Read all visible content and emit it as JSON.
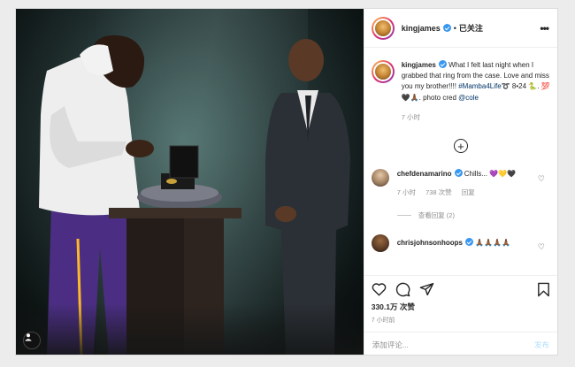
{
  "post": {
    "username": "kingjames",
    "follow_status": "已关注",
    "separator": "•",
    "more": "•••"
  },
  "caption": {
    "username": "kingjames",
    "text": "What I felt last night when I grabbed that ring from the case. Love and miss you my brother!!!!",
    "hashtag": "#Mamba4Life",
    "after_hashtag": "➰ 8•24 🐍. 💯🖤🙏🏾.",
    "photo_credit": "photo cred",
    "mention": "@cole",
    "time": "7 小时"
  },
  "comments": [
    {
      "username": "chefdenamarino",
      "text": "Chills... 💜💛🖤",
      "time": "7 小时",
      "likes": "738 次赞",
      "reply_label": "回复",
      "view_replies": "查看回复 (2)"
    },
    {
      "username": "chrisjohnsonhoops",
      "text": "🙏🏾🙏🏾🙏🏾🙏🏾"
    }
  ],
  "actions": {
    "likes_count": "330.1万 次赞",
    "post_time": "7 小时前"
  },
  "add_comment": {
    "placeholder": "添加评论...",
    "post_label": "发布"
  },
  "colors": {
    "verified": "#3897f0",
    "link": "#003569",
    "muted": "#8e8e8e",
    "post_button_disabled": "#b2dffc"
  },
  "icons": [
    "user-tag-icon",
    "more-icon",
    "verified-badge-icon",
    "heart-icon",
    "comment-icon",
    "share-icon",
    "bookmark-icon",
    "plus-circle-icon"
  ]
}
